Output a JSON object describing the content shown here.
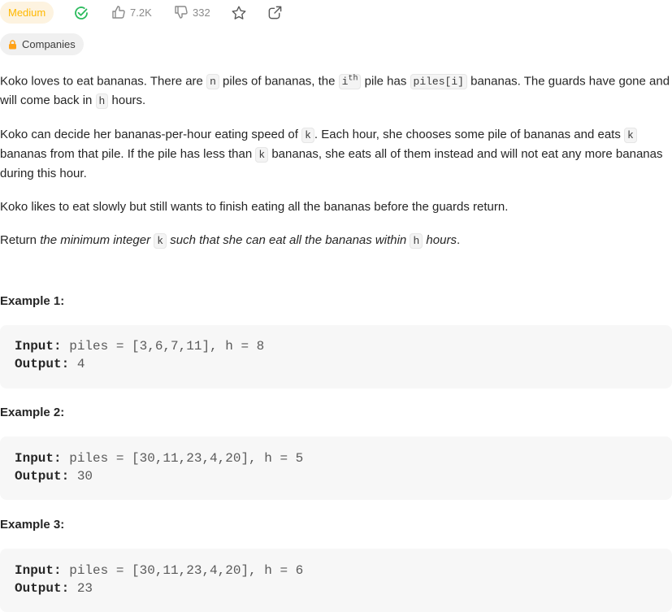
{
  "toolbar": {
    "difficulty": "Medium",
    "likes": "7.2K",
    "dislikes": "332",
    "colors": {
      "difficulty_text": "#ffb800",
      "difficulty_bg": "#fdf3e0",
      "solved": "#2cbb5d",
      "icon_gray": "#8a8a8a"
    }
  },
  "companies": {
    "label": "Companies",
    "icon": "lock-icon"
  },
  "description": {
    "p1": {
      "t1": "Koko loves to eat bananas. There are ",
      "c1": "n",
      "t2": " piles of bananas, the ",
      "c2_base": "i",
      "c2_sup": "th",
      "t3": " pile has ",
      "c3": "piles[i]",
      "t4": " bananas. The guards have gone and will come back in ",
      "c4": "h",
      "t5": " hours."
    },
    "p2": {
      "t1": "Koko can decide her bananas-per-hour eating speed of ",
      "c1": "k",
      "t2": ". Each hour, she chooses some pile of bananas and eats ",
      "c2": "k",
      "t3": " bananas from that pile. If the pile has less than ",
      "c3": "k",
      "t4": " bananas, she eats all of them instead and will not eat any more bananas during this hour."
    },
    "p3": "Koko likes to eat slowly but still wants to finish eating all the bananas before the guards return.",
    "p4": {
      "t1": "Return ",
      "e1": "the minimum integer ",
      "c1": "k",
      "e2": " such that she can eat all the bananas within ",
      "c2": "h",
      "e3": " hours",
      "t2": "."
    }
  },
  "examples": [
    {
      "title": "Example 1:",
      "input_label": "Input:",
      "input": " piles = [3,6,7,11], h = 8",
      "output_label": "Output:",
      "output": " 4"
    },
    {
      "title": "Example 2:",
      "input_label": "Input:",
      "input": " piles = [30,11,23,4,20], h = 5",
      "output_label": "Output:",
      "output": " 30"
    },
    {
      "title": "Example 3:",
      "input_label": "Input:",
      "input": " piles = [30,11,23,4,20], h = 6",
      "output_label": "Output:",
      "output": " 23"
    }
  ]
}
